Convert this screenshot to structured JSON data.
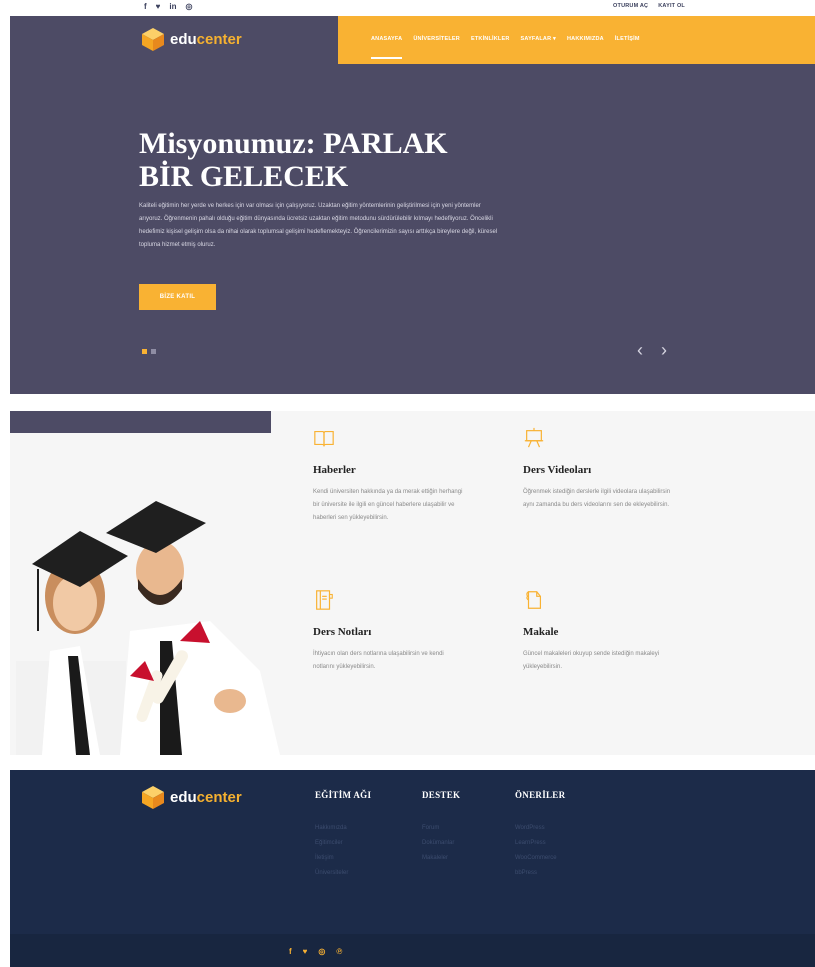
{
  "topbar": {
    "social": [
      {
        "name": "facebook-icon",
        "glyph": "f"
      },
      {
        "name": "twitter-icon",
        "glyph": "♥"
      },
      {
        "name": "linkedin-icon",
        "glyph": "in"
      },
      {
        "name": "instagram-icon",
        "glyph": "◎"
      }
    ],
    "login": "OTURUM AÇ",
    "register": "KAYIT OL"
  },
  "brand": {
    "part1": "edu",
    "part2": "center"
  },
  "nav": [
    {
      "label": "ANASAYFA",
      "active": true
    },
    {
      "label": "ÜNİVERSİTELER"
    },
    {
      "label": "ETKİNLİKLER"
    },
    {
      "label": "SAYFALAR ▾"
    },
    {
      "label": "HAKKIMIZDA"
    },
    {
      "label": "İLETİŞİM"
    }
  ],
  "hero": {
    "title": "Misyonumuz: PARLAK BİR GELECEK",
    "description": "Kaliteli eğitimin her yerde ve herkes için var olması için çalışıyoruz. Uzaktan eğitim yöntemlerinin geliştirilmesi için yeni yöntemler arıyoruz. Öğrenmenin pahalı olduğu eğitim dünyasında ücretsiz uzaktan eğitim metodunu sürdürülebilir kılmayı hedefliyoruz. Öncelikli hedefimiz kişisel gelişim olsa da nihai olarak toplumsal gelişimi hedeflemekteyiz. Öğrencilerimizin sayısı arttıkça bireylere değil, küresel topluma hizmet etmiş oluruz.",
    "button": "BİZE KATIL",
    "prev": "‹",
    "next": "›"
  },
  "features": [
    {
      "icon": "book-icon",
      "title": "Haberler",
      "text": "Kendi üniversiten hakkında ya da merak ettiğin herhangi bir üniversite ile ilgili en güncel haberlere ulaşabilir ve haberleri sen yükleyebilirsin."
    },
    {
      "icon": "presentation-board-icon",
      "title": "Ders Videoları",
      "text": "Öğrenmek istediğin derslerle ilgili videolara ulaşabilirsin aynı zamanda bu ders videolarını sen de ekleyebilirsin."
    },
    {
      "icon": "notebook-icon",
      "title": "Ders Notları",
      "text": "İhtiyacın olan ders notlarına ulaşabilirsin ve kendi notlarını yükleyebilirsin."
    },
    {
      "icon": "document-icon",
      "title": "Makale",
      "text": "Güncel makaleleri okuyup sende istediğin makaleyi yükleyebilirsin."
    }
  ],
  "footer": {
    "columns": [
      {
        "title": "EĞİTİM AĞI",
        "links": [
          "Hakkımızda",
          "Eğitimciler",
          "İletişim",
          "Üniversiteler"
        ]
      },
      {
        "title": "DESTEK",
        "links": [
          "Forum",
          "Dokümanlar",
          "Makaleler"
        ]
      },
      {
        "title": "ÖNERİLER",
        "links": [
          "WordPress",
          "LearnPress",
          "WooCommerce",
          "bbPress"
        ]
      }
    ],
    "social": [
      {
        "name": "facebook-icon",
        "glyph": "f"
      },
      {
        "name": "twitter-icon",
        "glyph": "♥"
      },
      {
        "name": "instagram-icon",
        "glyph": "◎"
      },
      {
        "name": "pinterest-icon",
        "glyph": "℗"
      }
    ]
  },
  "colors": {
    "accent": "#f9b233",
    "hero_bg": "#4d4b65",
    "footer_bg": "#1c2b49"
  }
}
